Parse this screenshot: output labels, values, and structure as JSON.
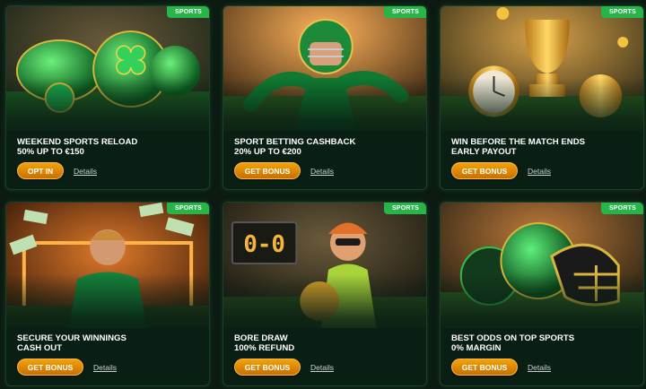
{
  "badge_label": "SPORTS",
  "details_label": "Details",
  "colors": {
    "badge": "#27b54a",
    "button": "#e08a05",
    "background": "#0c1a12"
  },
  "cards": [
    {
      "title_line1": "WEEKEND SPORTS RELOAD",
      "title_line2": "50% UP TO €150",
      "button": "OPT IN",
      "image": "clover-balls-on-grass"
    },
    {
      "title_line1": "SPORT BETTING CASHBACK",
      "title_line2": "20% UP TO €200",
      "button": "GET BONUS",
      "image": "football-player-in-stadium"
    },
    {
      "title_line1": "WIN BEFORE THE MATCH ENDS",
      "title_line2": "EARLY PAYOUT",
      "button": "GET BONUS",
      "image": "trophy-and-stopwatch"
    },
    {
      "title_line1": "SECURE YOUR WINNINGS",
      "title_line2": "CASH OUT",
      "button": "GET BONUS",
      "image": "player-with-cash-at-goal"
    },
    {
      "title_line1": "BORE DRAW",
      "title_line2": "100% REFUND",
      "button": "GET BONUS",
      "image": "fan-with-ball-and-0-0-scoreboard",
      "scoreboard": "0-0"
    },
    {
      "title_line1": "BEST ODDS ON TOP SPORTS",
      "title_line2": "0% MARGIN",
      "button": "GET BONUS",
      "image": "helmet-and-balls-on-grass"
    }
  ]
}
